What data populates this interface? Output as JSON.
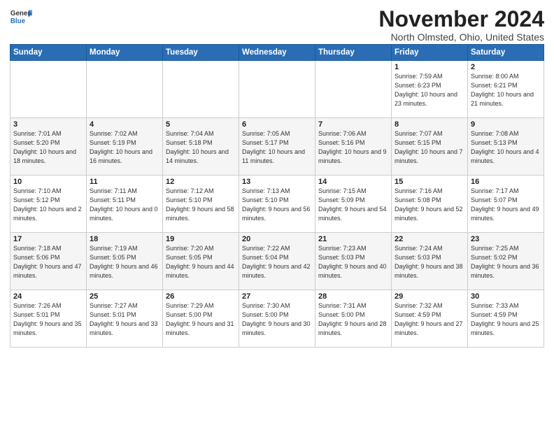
{
  "logo": {
    "line1": "General",
    "line2": "Blue"
  },
  "title": "November 2024",
  "location": "North Olmsted, Ohio, United States",
  "days_of_week": [
    "Sunday",
    "Monday",
    "Tuesday",
    "Wednesday",
    "Thursday",
    "Friday",
    "Saturday"
  ],
  "weeks": [
    [
      {
        "day": "",
        "info": ""
      },
      {
        "day": "",
        "info": ""
      },
      {
        "day": "",
        "info": ""
      },
      {
        "day": "",
        "info": ""
      },
      {
        "day": "",
        "info": ""
      },
      {
        "day": "1",
        "info": "Sunrise: 7:59 AM\nSunset: 6:23 PM\nDaylight: 10 hours\nand 23 minutes."
      },
      {
        "day": "2",
        "info": "Sunrise: 8:00 AM\nSunset: 6:21 PM\nDaylight: 10 hours\nand 21 minutes."
      }
    ],
    [
      {
        "day": "3",
        "info": "Sunrise: 7:01 AM\nSunset: 5:20 PM\nDaylight: 10 hours\nand 18 minutes."
      },
      {
        "day": "4",
        "info": "Sunrise: 7:02 AM\nSunset: 5:19 PM\nDaylight: 10 hours\nand 16 minutes."
      },
      {
        "day": "5",
        "info": "Sunrise: 7:04 AM\nSunset: 5:18 PM\nDaylight: 10 hours\nand 14 minutes."
      },
      {
        "day": "6",
        "info": "Sunrise: 7:05 AM\nSunset: 5:17 PM\nDaylight: 10 hours\nand 11 minutes."
      },
      {
        "day": "7",
        "info": "Sunrise: 7:06 AM\nSunset: 5:16 PM\nDaylight: 10 hours\nand 9 minutes."
      },
      {
        "day": "8",
        "info": "Sunrise: 7:07 AM\nSunset: 5:15 PM\nDaylight: 10 hours\nand 7 minutes."
      },
      {
        "day": "9",
        "info": "Sunrise: 7:08 AM\nSunset: 5:13 PM\nDaylight: 10 hours\nand 4 minutes."
      }
    ],
    [
      {
        "day": "10",
        "info": "Sunrise: 7:10 AM\nSunset: 5:12 PM\nDaylight: 10 hours\nand 2 minutes."
      },
      {
        "day": "11",
        "info": "Sunrise: 7:11 AM\nSunset: 5:11 PM\nDaylight: 10 hours\nand 0 minutes."
      },
      {
        "day": "12",
        "info": "Sunrise: 7:12 AM\nSunset: 5:10 PM\nDaylight: 9 hours\nand 58 minutes."
      },
      {
        "day": "13",
        "info": "Sunrise: 7:13 AM\nSunset: 5:10 PM\nDaylight: 9 hours\nand 56 minutes."
      },
      {
        "day": "14",
        "info": "Sunrise: 7:15 AM\nSunset: 5:09 PM\nDaylight: 9 hours\nand 54 minutes."
      },
      {
        "day": "15",
        "info": "Sunrise: 7:16 AM\nSunset: 5:08 PM\nDaylight: 9 hours\nand 52 minutes."
      },
      {
        "day": "16",
        "info": "Sunrise: 7:17 AM\nSunset: 5:07 PM\nDaylight: 9 hours\nand 49 minutes."
      }
    ],
    [
      {
        "day": "17",
        "info": "Sunrise: 7:18 AM\nSunset: 5:06 PM\nDaylight: 9 hours\nand 47 minutes."
      },
      {
        "day": "18",
        "info": "Sunrise: 7:19 AM\nSunset: 5:05 PM\nDaylight: 9 hours\nand 46 minutes."
      },
      {
        "day": "19",
        "info": "Sunrise: 7:20 AM\nSunset: 5:05 PM\nDaylight: 9 hours\nand 44 minutes."
      },
      {
        "day": "20",
        "info": "Sunrise: 7:22 AM\nSunset: 5:04 PM\nDaylight: 9 hours\nand 42 minutes."
      },
      {
        "day": "21",
        "info": "Sunrise: 7:23 AM\nSunset: 5:03 PM\nDaylight: 9 hours\nand 40 minutes."
      },
      {
        "day": "22",
        "info": "Sunrise: 7:24 AM\nSunset: 5:03 PM\nDaylight: 9 hours\nand 38 minutes."
      },
      {
        "day": "23",
        "info": "Sunrise: 7:25 AM\nSunset: 5:02 PM\nDaylight: 9 hours\nand 36 minutes."
      }
    ],
    [
      {
        "day": "24",
        "info": "Sunrise: 7:26 AM\nSunset: 5:01 PM\nDaylight: 9 hours\nand 35 minutes."
      },
      {
        "day": "25",
        "info": "Sunrise: 7:27 AM\nSunset: 5:01 PM\nDaylight: 9 hours\nand 33 minutes."
      },
      {
        "day": "26",
        "info": "Sunrise: 7:29 AM\nSunset: 5:00 PM\nDaylight: 9 hours\nand 31 minutes."
      },
      {
        "day": "27",
        "info": "Sunrise: 7:30 AM\nSunset: 5:00 PM\nDaylight: 9 hours\nand 30 minutes."
      },
      {
        "day": "28",
        "info": "Sunrise: 7:31 AM\nSunset: 5:00 PM\nDaylight: 9 hours\nand 28 minutes."
      },
      {
        "day": "29",
        "info": "Sunrise: 7:32 AM\nSunset: 4:59 PM\nDaylight: 9 hours\nand 27 minutes."
      },
      {
        "day": "30",
        "info": "Sunrise: 7:33 AM\nSunset: 4:59 PM\nDaylight: 9 hours\nand 25 minutes."
      }
    ]
  ]
}
